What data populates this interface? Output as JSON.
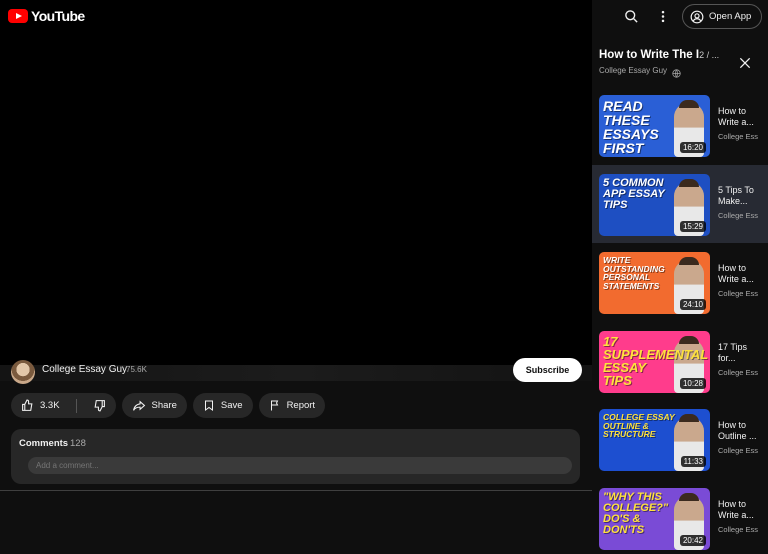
{
  "app": {
    "logo_text": "YouTube"
  },
  "header": {
    "open_app_label": "Open App"
  },
  "video": {
    "channel_name": "College Essay Guy",
    "subscriber_count": "75.6K",
    "subscribe_label": "Subscribe",
    "like_count": "3.3K",
    "share_label": "Share",
    "save_label": "Save",
    "report_label": "Report"
  },
  "comments": {
    "title": "Comments",
    "count": "128",
    "placeholder": "Add a comment..."
  },
  "playlist": {
    "title": "How to Write The I",
    "position": "2 / ...",
    "channel": "College Essay Guy",
    "items": [
      {
        "thumb_text": "READ THESE ESSAYS FIRST",
        "duration": "16:20",
        "title": "How to Write a...",
        "channel": "College Ess",
        "bg": "#2a5fd6",
        "text_color": "#ffffff",
        "accent": "#f2c42b"
      },
      {
        "thumb_text": "5 COMMON APP ESSAY TIPS",
        "duration": "15:29",
        "title": "5 Tips To Make...",
        "channel": "College Ess",
        "bg": "#1e4fc2",
        "text_color": "#ffffff",
        "accent": "#ff5aa5"
      },
      {
        "thumb_text": "WRITE OUTSTANDING PERSONAL STATEMENTS",
        "duration": "24:10",
        "title": "How to Write a...",
        "channel": "College Ess",
        "bg": "#f26b2f",
        "text_color": "#ffffff",
        "accent": "#ffffff"
      },
      {
        "thumb_text": "17 SUPPLEMENTAL ESSAY TIPS",
        "duration": "10:28",
        "title": "17 Tips for...",
        "channel": "College Ess",
        "bg": "#ff3c8c",
        "text_color": "#ffe23c",
        "accent": "#ffe23c"
      },
      {
        "thumb_text": "COLLEGE ESSAY OUTLINE & STRUCTURE",
        "duration": "11:33",
        "title": "How to Outline ...",
        "channel": "College Ess",
        "bg": "#1d4fd0",
        "text_color": "#ffe23c",
        "accent": "#ffffff"
      },
      {
        "thumb_text": "\"WHY THIS COLLEGE?\" DO'S & DON'TS",
        "duration": "20:42",
        "title": "How to Write a...",
        "channel": "College Ess",
        "bg": "#7a4bd6",
        "text_color": "#ffe23c",
        "accent": "#ffffff"
      }
    ],
    "active_index": 1
  },
  "colors": {
    "brand_red": "#ff0000",
    "panel_bg": "#0f0f0f",
    "active_row": "#272a33"
  }
}
